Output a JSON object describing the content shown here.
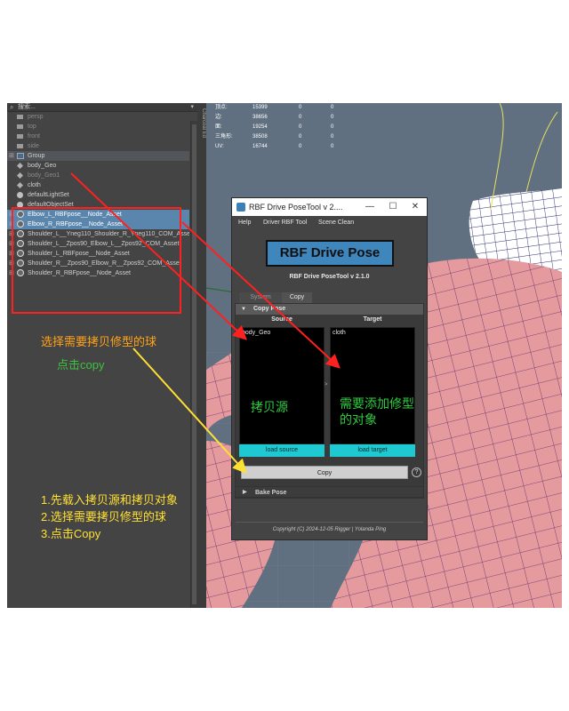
{
  "outliner": {
    "search_placeholder": "搜索...",
    "rows": [
      {
        "label": "persp",
        "kind": "camera",
        "style": "dim",
        "expander": ""
      },
      {
        "label": "top",
        "kind": "camera",
        "style": "dim",
        "expander": ""
      },
      {
        "label": "front",
        "kind": "camera",
        "style": "dim",
        "expander": ""
      },
      {
        "label": "side",
        "kind": "camera",
        "style": "dim",
        "expander": ""
      },
      {
        "label": "Group",
        "kind": "group",
        "style": "grp",
        "expander": "⊞"
      },
      {
        "label": "body_Geo",
        "kind": "mesh",
        "style": "",
        "expander": ""
      },
      {
        "label": "body_Geo1",
        "kind": "mesh",
        "style": "dim",
        "expander": ""
      },
      {
        "label": "cloth",
        "kind": "mesh",
        "style": "",
        "expander": ""
      },
      {
        "label": "defaultLightSet",
        "kind": "light",
        "style": "",
        "expander": ""
      },
      {
        "label": "defaultObjectSet",
        "kind": "light",
        "style": "",
        "expander": ""
      },
      {
        "label": "Elbow_L_RBFpose__Node_Asset",
        "kind": "node",
        "style": "sel",
        "expander": "⊞"
      },
      {
        "label": "Elbow_R_RBFpose__Node_Asset",
        "kind": "node",
        "style": "sel",
        "expander": "⊞"
      },
      {
        "label": "Shoulder_L__Yneg110_Shoulder_R_Yneg110_COM_Asset",
        "kind": "node",
        "style": "",
        "expander": "⊞"
      },
      {
        "label": "Shoulder_L__Zpos90_Elbow_L__Zpos92_COM_Asset",
        "kind": "node",
        "style": "",
        "expander": "⊞"
      },
      {
        "label": "Shoulder_L_RBFpose__Node_Asset",
        "kind": "node",
        "style": "",
        "expander": "⊞"
      },
      {
        "label": "Shoulder_R__Zpos90_Elbow_R__Zpos92_COM_Asset",
        "kind": "node",
        "style": "",
        "expander": "⊞"
      },
      {
        "label": "Shoulder_R_RBFpose__Node_Asset",
        "kind": "node",
        "style": "",
        "expander": "⊞"
      }
    ]
  },
  "channel_strip_label": "Charcoal Ed",
  "hud": [
    {
      "label": "顶点:",
      "a": "15399",
      "b": "0",
      "c": "0"
    },
    {
      "label": "边:",
      "a": "38656",
      "b": "0",
      "c": "0"
    },
    {
      "label": "面:",
      "a": "19254",
      "b": "0",
      "c": "0"
    },
    {
      "label": "三角形:",
      "a": "38508",
      "b": "0",
      "c": "0"
    },
    {
      "label": "UV:",
      "a": "16744",
      "b": "0",
      "c": "0"
    }
  ],
  "annotations": {
    "select_ball": "选择需要拷贝修型的球",
    "click_copy": "点击copy",
    "step1": "1.先载入拷贝源和拷贝对象",
    "step2": "2.选择需要拷贝修型的球",
    "step3": "3.点击Copy"
  },
  "rbf": {
    "window_title": "RBF Drive PoseTool v 2....",
    "min_icon": "—",
    "max_icon": "☐",
    "close_icon": "✕",
    "menu": [
      "Help",
      "Driver RBF Tool",
      "Scene Clean"
    ],
    "logo": "RBF Drive Pose",
    "version": "RBF Drive PoseTool v 2.1.0",
    "tabs": [
      "System",
      "Copy"
    ],
    "copy_section": "Copy Pose",
    "source_header": "Source",
    "target_header": "Target",
    "source_item": "body_Geo",
    "target_item": "cloth",
    "source_note": "拷贝源",
    "target_note_1": "需要添加修型",
    "target_note_2": "的对象",
    "load_source": "load source",
    "load_target": "load target",
    "copy_button": "Copy",
    "help": "?",
    "bake_section": "Bake Pose",
    "footer": "Copyright (C)  2024-12-05 Rigger  | Yolanda Ping"
  },
  "colors": {
    "accent_blue": "#3f86bd",
    "cyan_button": "#1fc9d1",
    "selection": "#5a86ad",
    "annotation_orange": "#ffa31a",
    "annotation_green": "#40c040",
    "annotation_yellow": "#ffe033",
    "arrow_red": "#ff2020"
  }
}
